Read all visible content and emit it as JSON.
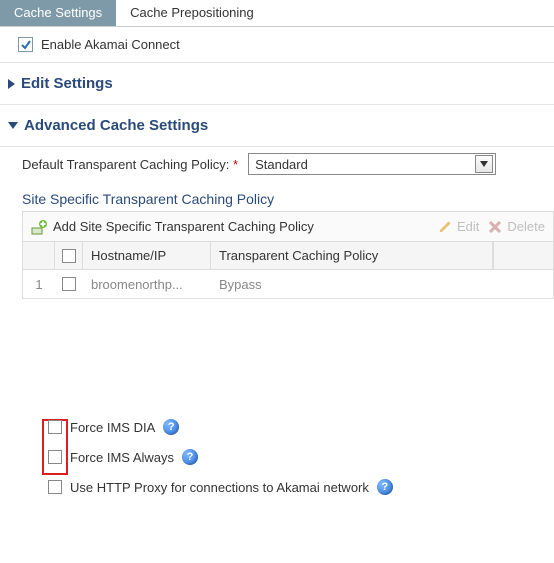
{
  "tabs": {
    "cache_settings": "Cache Settings",
    "cache_prepositioning": "Cache Prepositioning"
  },
  "enable_row": {
    "label": "Enable Akamai Connect",
    "checked": true
  },
  "edit_settings_header": "Edit Settings",
  "advanced_header": "Advanced Cache Settings",
  "default_policy": {
    "label": "Default Transparent Caching Policy:",
    "selected": "Standard"
  },
  "site_specific_header": "Site Specific Transparent Caching Policy",
  "toolbar": {
    "add_label": "Add Site Specific Transparent Caching Policy",
    "edit_label": "Edit",
    "delete_label": "Delete"
  },
  "table": {
    "headers": {
      "hostname": "Hostname/IP",
      "policy": "Transparent Caching Policy"
    },
    "rows": [
      {
        "idx": "1",
        "hostname": "broomenorthp...",
        "policy": "Bypass"
      }
    ]
  },
  "options": {
    "force_ims_dia": "Force IMS DIA",
    "force_ims_always": "Force IMS Always",
    "use_http_proxy": "Use HTTP Proxy for connections to Akamai network"
  }
}
